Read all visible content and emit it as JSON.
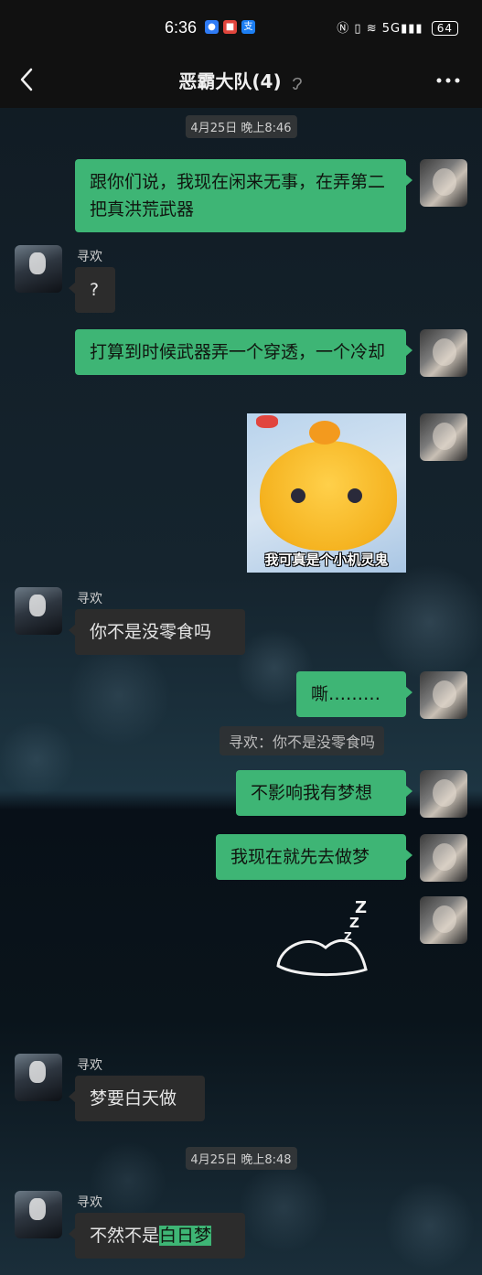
{
  "status": {
    "time": "6:36",
    "battery": "64",
    "network": "5G",
    "notif_icons": [
      "message-icon",
      "app-icon",
      "alipay-icon"
    ]
  },
  "header": {
    "title": "恶霸大队(4)"
  },
  "messages": {
    "ts1": "4月25日 晚上8:46",
    "m1": "跟你们说，我现在闲来无事，在弄第二把真洪荒武器",
    "sender": "寻欢",
    "m2": "?",
    "m3": "打算到时候武器弄一个穿透，一个冷却",
    "sticker_caption": "我可真是个小机灵鬼",
    "m4": "你不是没零食吗",
    "m5": "嘶………",
    "quote": "寻欢：你不是没零食吗",
    "m6": "不影响我有梦想",
    "m7": "我现在就先去做梦",
    "sleep_sticker": "zzz-sleep-sticker",
    "m8": "梦要白天做",
    "ts2": "4月25日 晚上8:48",
    "m9_prefix": "不然不是",
    "m9_highlight": "白日梦"
  },
  "colors": {
    "self_bubble": "#3eb575",
    "other_bubble": "#2c2c2c",
    "bar": "#111111"
  }
}
